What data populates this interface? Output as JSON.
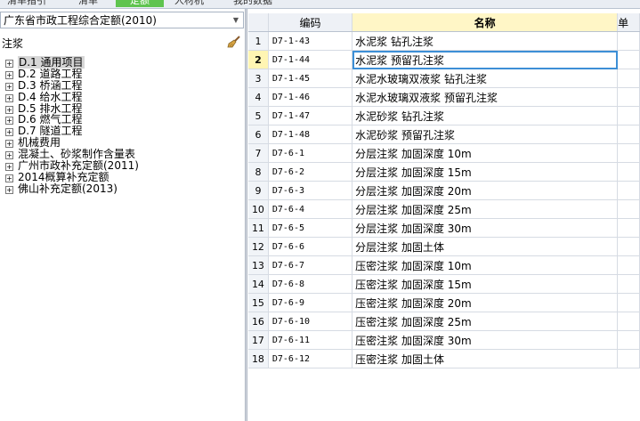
{
  "toolbar": {
    "tabs": [
      {
        "label": "清单指引",
        "active": false
      },
      {
        "label": "清单",
        "active": false
      },
      {
        "label": "定额",
        "active": true
      },
      {
        "label": "人材机",
        "active": false
      },
      {
        "label": "我的数据",
        "active": false
      }
    ]
  },
  "library": {
    "selected": "广东省市政工程综合定额(2010)"
  },
  "search": {
    "value": "注浆"
  },
  "tree": {
    "items": [
      {
        "label": "D.1 通用项目",
        "selected": true
      },
      {
        "label": "D.2 道路工程"
      },
      {
        "label": "D.3 桥涵工程"
      },
      {
        "label": "D.4 给水工程"
      },
      {
        "label": "D.5 排水工程"
      },
      {
        "label": "D.6 燃气工程"
      },
      {
        "label": "D.7 隧道工程"
      },
      {
        "label": "机械费用"
      },
      {
        "label": "混凝土、砂浆制作含量表"
      },
      {
        "label": "广州市政补充定额(2011)"
      },
      {
        "label": "2014概算补充定额"
      },
      {
        "label": "佛山补充定额(2013)"
      }
    ]
  },
  "grid": {
    "headers": {
      "index": "",
      "code": "编码",
      "name": "名称",
      "extra": "单"
    },
    "current_row": 2,
    "rows": [
      {
        "index": "1",
        "code": "D7-1-43",
        "name": "水泥浆 钻孔注浆"
      },
      {
        "index": "2",
        "code": "D7-1-44",
        "name": "水泥浆 预留孔注浆"
      },
      {
        "index": "3",
        "code": "D7-1-45",
        "name": "水泥水玻璃双液浆 钻孔注浆"
      },
      {
        "index": "4",
        "code": "D7-1-46",
        "name": "水泥水玻璃双液浆 预留孔注浆"
      },
      {
        "index": "5",
        "code": "D7-1-47",
        "name": "水泥砂浆 钻孔注浆"
      },
      {
        "index": "6",
        "code": "D7-1-48",
        "name": "水泥砂浆 预留孔注浆"
      },
      {
        "index": "7",
        "code": "D7-6-1",
        "name": "分层注浆 加固深度 10m"
      },
      {
        "index": "8",
        "code": "D7-6-2",
        "name": "分层注浆 加固深度 15m"
      },
      {
        "index": "9",
        "code": "D7-6-3",
        "name": "分层注浆 加固深度 20m"
      },
      {
        "index": "10",
        "code": "D7-6-4",
        "name": "分层注浆 加固深度 25m"
      },
      {
        "index": "11",
        "code": "D7-6-5",
        "name": "分层注浆 加固深度 30m"
      },
      {
        "index": "12",
        "code": "D7-6-6",
        "name": "分层注浆 加固土体"
      },
      {
        "index": "13",
        "code": "D7-6-7",
        "name": "压密注浆 加固深度 10m"
      },
      {
        "index": "14",
        "code": "D7-6-8",
        "name": "压密注浆 加固深度 15m"
      },
      {
        "index": "15",
        "code": "D7-6-9",
        "name": "压密注浆 加固深度 20m"
      },
      {
        "index": "16",
        "code": "D7-6-10",
        "name": "压密注浆 加固深度 25m"
      },
      {
        "index": "17",
        "code": "D7-6-11",
        "name": "压密注浆 加固深度 30m"
      },
      {
        "index": "18",
        "code": "D7-6-12",
        "name": "压密注浆 加固土体"
      }
    ]
  },
  "colors": {
    "active_tab": "#5fc44f",
    "header_name_bg": "#fff6c6",
    "current_cell_border": "#3d8fd6"
  }
}
